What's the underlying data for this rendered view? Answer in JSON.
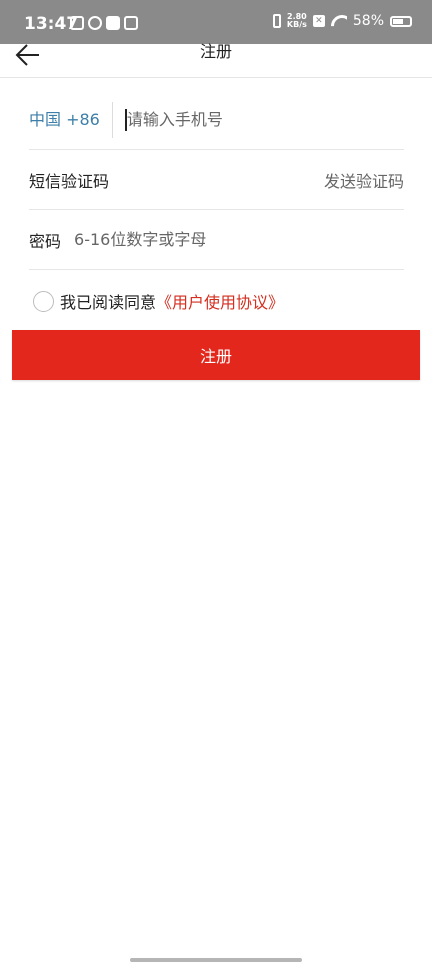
{
  "status_bar": {
    "time": "13:47",
    "net_speed_value": "2.80",
    "net_speed_unit": "KB/s",
    "x_badge": "✕",
    "battery": "58%"
  },
  "header": {
    "title": "注册",
    "back_icon": "arrow-left-icon"
  },
  "form": {
    "country_code": "中国 +86",
    "phone_placeholder": "请输入手机号",
    "sms_label": "短信验证码",
    "send_code": "发送验证码",
    "password_label": "密码",
    "password_placeholder": "6-16位数字或字母"
  },
  "agreement": {
    "text": "我已阅读同意",
    "link": "《用户使用协议》",
    "checked": false
  },
  "register_button": "注册",
  "colors": {
    "accent": "#e3271c",
    "link": "#d42e1f",
    "country": "#3d7fa8",
    "status_bar": "#8a8a8a"
  }
}
